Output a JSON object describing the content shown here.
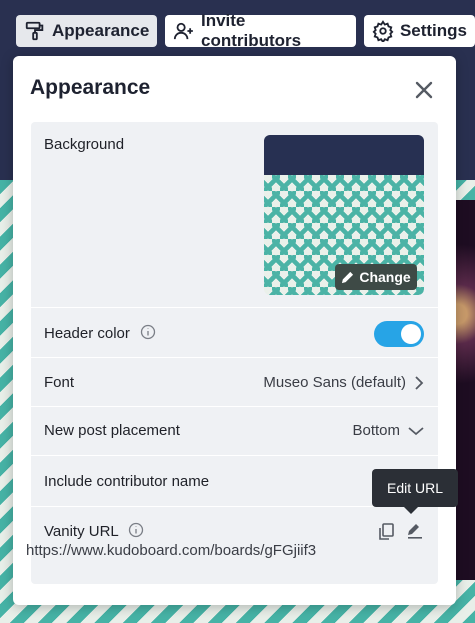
{
  "toolbar": {
    "appearance_label": "Appearance",
    "invite_label": "Invite contributors",
    "settings_label": "Settings"
  },
  "panel": {
    "title": "Appearance",
    "background": {
      "label": "Background",
      "change_label": "Change"
    },
    "header_color": {
      "label": "Header color",
      "enabled": true
    },
    "font": {
      "label": "Font",
      "value": "Museo Sans (default)"
    },
    "new_post_placement": {
      "label": "New post placement",
      "value": "Bottom"
    },
    "include_contributor": {
      "label": "Include contributor name"
    },
    "vanity_url": {
      "label": "Vanity URL",
      "url": "https://www.kudoboard.com/boards/gFGjiif3",
      "tooltip": "Edit URL"
    }
  },
  "colors": {
    "accent": "#27a4e6",
    "header_navy": "#273052",
    "pattern_teal": "#4bb3a6",
    "tooltip_bg": "#2b2f36"
  }
}
